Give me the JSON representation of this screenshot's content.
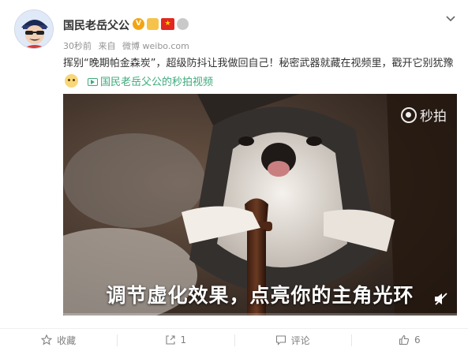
{
  "post": {
    "username": "国民老岳父公",
    "badges": {
      "v": "V",
      "crown": "",
      "flag": "★",
      "medal": ""
    },
    "meta": {
      "time": "30秒前",
      "source_prefix": "来自",
      "source": "微博 weibo.com"
    },
    "text": "挥别“晚期帕金森炭”，超级防抖让我做回自己！秘密武器就藏在视频里，戳开它别犹豫",
    "link_label": "国民老岳父公的秒拍视频"
  },
  "video": {
    "watermark": "秒拍",
    "subtitle": "调节虚化效果，点亮你的主角光环",
    "progress": 0.0
  },
  "actions": [
    {
      "label": "收藏",
      "icon": "star-icon"
    },
    {
      "label": "1",
      "icon": "share-icon"
    },
    {
      "label": "评论",
      "icon": "comment-icon"
    },
    {
      "label": "6",
      "icon": "like-icon"
    }
  ],
  "colors": {
    "accent": "#ff8200",
    "link": "#3daa7b",
    "verified": "#f2a413"
  }
}
